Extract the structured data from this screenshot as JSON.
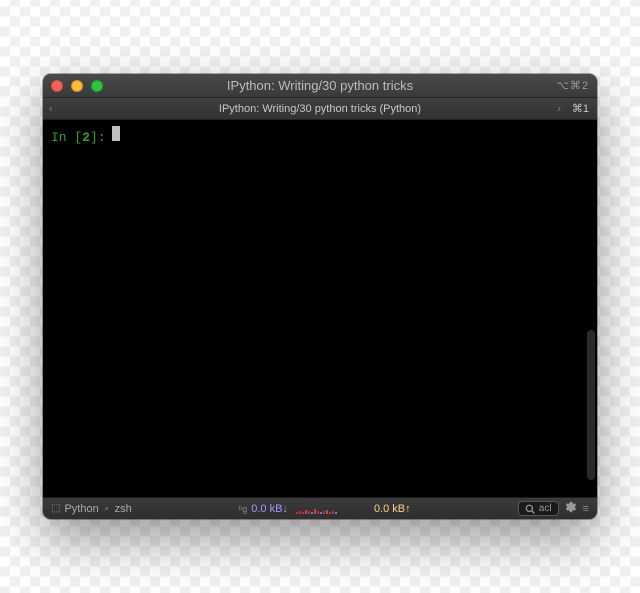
{
  "titlebar": {
    "title": "IPython: Writing/30 python tricks",
    "right_hint": "⌥⌘2"
  },
  "tabbar": {
    "active_tab": "IPython: Writing/30 python tricks (Python)",
    "tab_shortcut": "⌘1"
  },
  "terminal": {
    "prompt_in": "In [",
    "prompt_num": "2",
    "prompt_close": "]:"
  },
  "statusbar": {
    "session_icon_label": "⬚",
    "session_name": "Python",
    "shell": "zsh",
    "net_prefix": "ᵇg",
    "net_down_value": "0.0 kB↓",
    "net_up_value": "0.0 kB↑",
    "search_placeholder": "acl"
  }
}
